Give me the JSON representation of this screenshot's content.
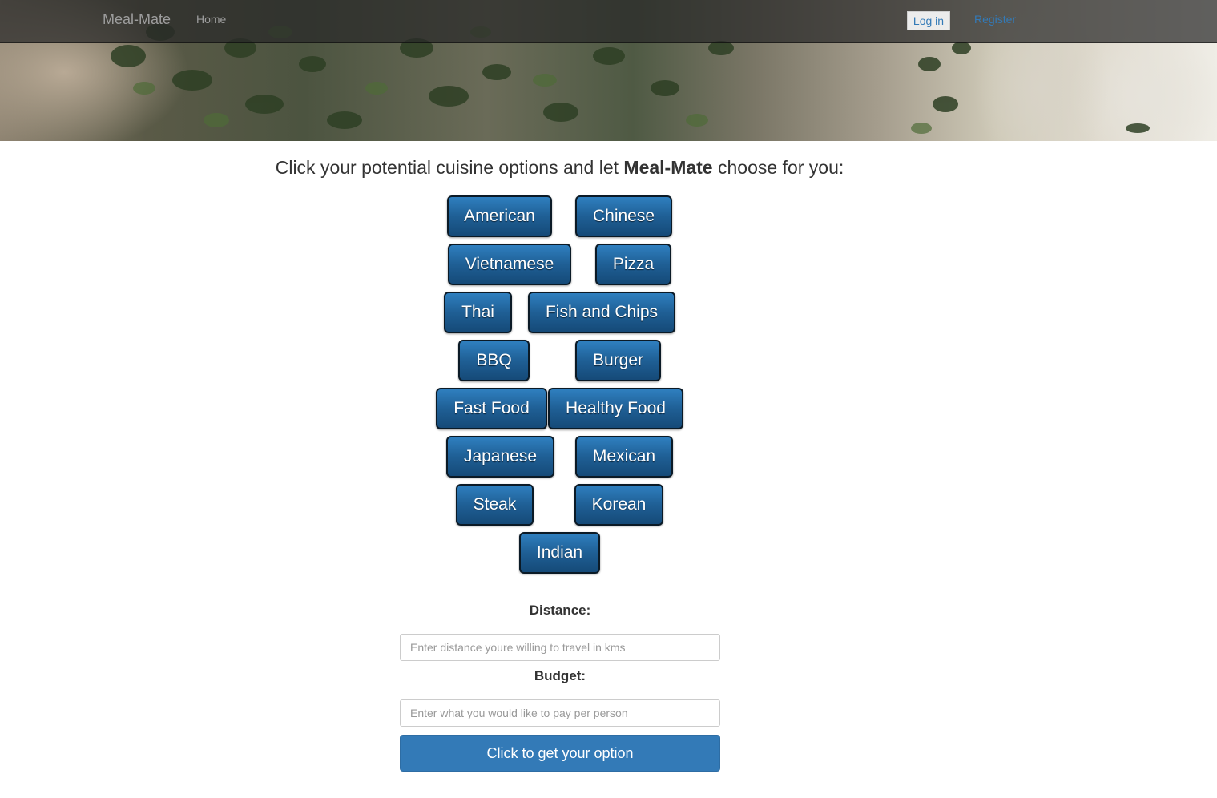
{
  "navbar": {
    "brand": "Meal-Mate",
    "home": "Home",
    "login": "Log in",
    "register": "Register"
  },
  "main": {
    "heading_prefix": "Click your potential cuisine options and let ",
    "heading_brand": "Meal-Mate",
    "heading_suffix": " choose for you:",
    "cuisines": [
      "American",
      "Chinese",
      "Vietnamese",
      "Pizza",
      "Thai",
      "Fish and Chips",
      "BBQ",
      "Burger",
      "Fast Food",
      "Healthy Food",
      "Japanese",
      "Mexican",
      "Steak",
      "Korean",
      "Indian"
    ]
  },
  "form": {
    "distance_label": "Distance:",
    "distance_placeholder": "Enter distance youre willing to travel in kms",
    "distance_value": "",
    "budget_label": "Budget:",
    "budget_placeholder": "Enter what you would like to pay per person",
    "budget_value": "",
    "submit_label": "Click to get your option"
  },
  "colors": {
    "primary": "#337ab7",
    "cuisine_button": "#1f5f95"
  }
}
